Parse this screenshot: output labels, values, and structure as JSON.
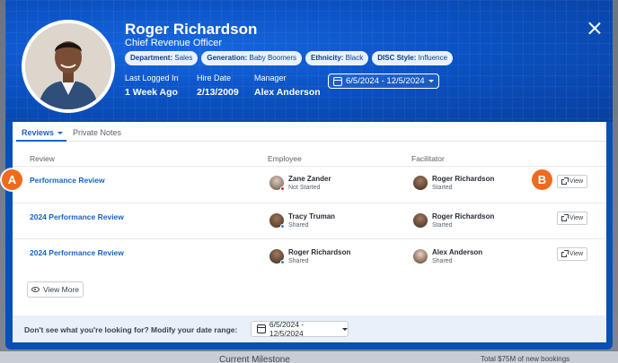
{
  "profile": {
    "name": "Roger Richardson",
    "title": "Chief Revenue Officer",
    "tags": [
      {
        "key": "Department:",
        "value": "Sales"
      },
      {
        "key": "Generation:",
        "value": "Baby Boomers"
      },
      {
        "key": "Ethnicity:",
        "value": "Black"
      },
      {
        "key": "DISC Style:",
        "value": "Influence"
      }
    ],
    "last_logged_in_label": "Last Logged In",
    "last_logged_in_value": "1 Week Ago",
    "hire_date_label": "Hire Date",
    "hire_date_value": "2/13/2009",
    "manager_label": "Manager",
    "manager_value": "Alex Anderson",
    "date_range": "6/5/2024 - 12/5/2024"
  },
  "tabs": {
    "reviews": "Reviews",
    "private_notes": "Private Notes"
  },
  "table": {
    "headers": [
      "Review",
      "Employee",
      "Facilitator"
    ],
    "view_label": "View",
    "rows": [
      {
        "review": "Performance Review",
        "employee": {
          "name": "Zane Zander",
          "status": "Not Started",
          "status_color": "#e0302a"
        },
        "facilitator": {
          "name": "Roger Richardson",
          "status": "Started"
        }
      },
      {
        "review": "2024 Performance Review",
        "employee": {
          "name": "Tracy Truman",
          "status": "Shared",
          "status_color": "#2a8be0"
        },
        "facilitator": {
          "name": "Roger Richardson",
          "status": "Started"
        }
      },
      {
        "review": "2024 Performance Review",
        "employee": {
          "name": "Roger Richardson",
          "status": "Shared",
          "status_color": "#2a8be0"
        },
        "facilitator": {
          "name": "Alex Anderson",
          "status": "Shared"
        }
      }
    ],
    "view_more": "View More"
  },
  "footer": {
    "prompt": "Don't see what you're looking for? Modify your date range:",
    "date_range": "6/5/2024 - 12/5/2024"
  },
  "badges": {
    "a": "A",
    "b": "B"
  },
  "backdrop": {
    "left_text": "Current Milestone",
    "right_text": "Total $75M of new bookings"
  },
  "colors": {
    "accent": "#1464c8",
    "hero": "#0a4fb8",
    "badge": "#ee6b1e"
  }
}
